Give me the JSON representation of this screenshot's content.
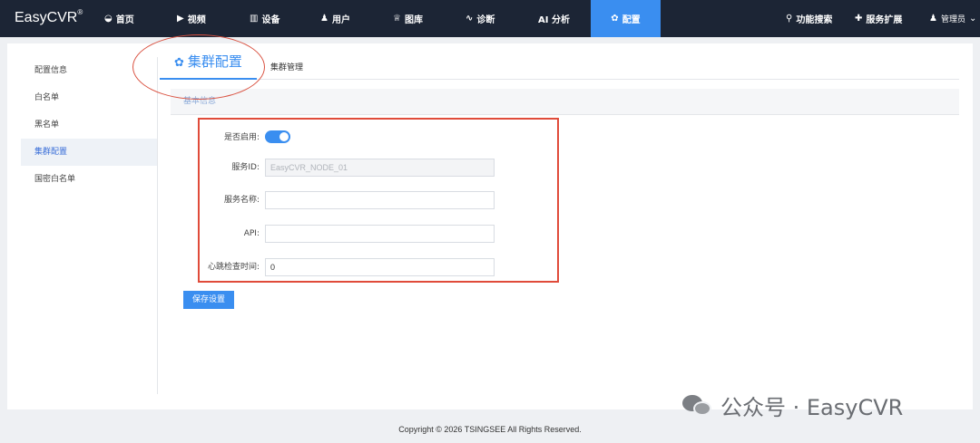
{
  "brand": {
    "name": "EasyCVR",
    "mark": "®"
  },
  "nav": {
    "items": [
      {
        "label": "首页",
        "icon": "dashboard-icon"
      },
      {
        "label": "视频",
        "icon": "play-icon"
      },
      {
        "label": "设备",
        "icon": "device-icon"
      },
      {
        "label": "用户",
        "icon": "user-icon"
      },
      {
        "label": "图库",
        "icon": "gallery-icon"
      },
      {
        "label": "诊断",
        "icon": "pulse-icon"
      },
      {
        "label": "AI 分析",
        "icon": ""
      },
      {
        "label": "配置",
        "icon": "gear-icon",
        "active": true
      }
    ],
    "right": [
      {
        "label": "功能搜索",
        "icon": "search-icon"
      },
      {
        "label": "服务扩展",
        "icon": "puzzle-icon"
      }
    ],
    "user": "管理员",
    "accent": "#3a8ef0"
  },
  "sidebar": {
    "items": [
      {
        "label": "配置信息"
      },
      {
        "label": "白名单"
      },
      {
        "label": "黑名单"
      },
      {
        "label": "集群配置",
        "active": true
      },
      {
        "label": "国密白名单"
      }
    ]
  },
  "tabs": [
    {
      "label": "集群配置",
      "active": true
    },
    {
      "label": "集群管理"
    }
  ],
  "section": {
    "title": "基本信息"
  },
  "form": {
    "enabled_label": "是否启用:",
    "enabled": true,
    "service_id_label": "服务ID:",
    "service_id_placeholder": "EasyCVR_NODE_01",
    "service_name_label": "服务名称:",
    "service_name_value": "",
    "api_label": "API:",
    "api_value": "",
    "heartbeat_label": "心跳检查时间:",
    "heartbeat_value": "0"
  },
  "save_button": "保存设置",
  "watermark": "公众号 · EasyCVR",
  "footer": "Copyright © 2026 TSINGSEE All Rights Reserved.",
  "colors": {
    "nav_bg": "#1c2535",
    "accent": "#3a8ef0",
    "highlight": "#e04b3a"
  }
}
